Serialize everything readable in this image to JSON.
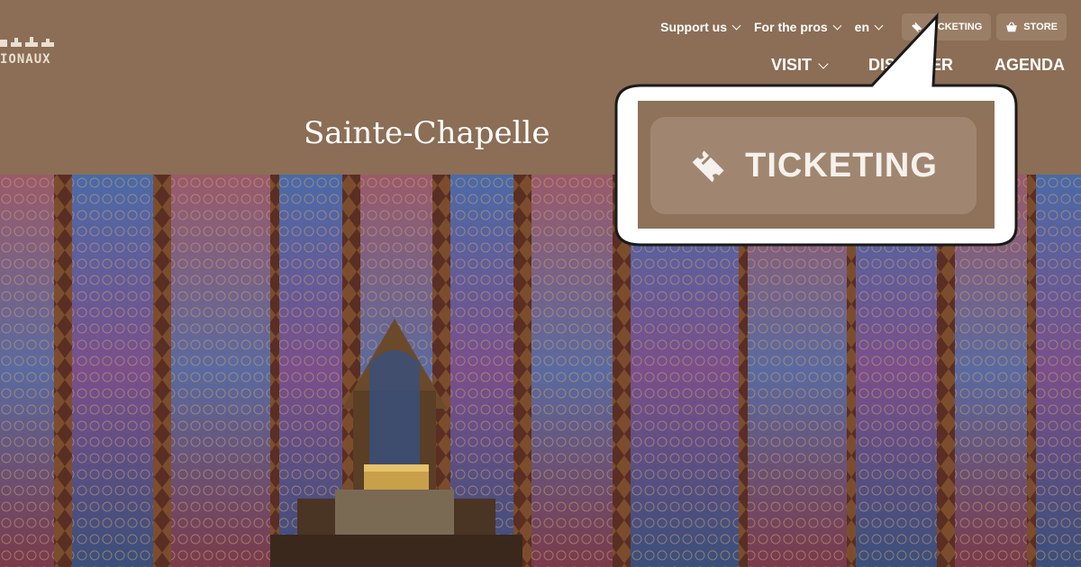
{
  "header": {
    "logo_text": "IONAUX",
    "topnav": {
      "support_label": "Support us",
      "pros_label": "For the pros",
      "lang_label": "en",
      "ticketing_label": "TICKETING",
      "store_label": "STORE"
    },
    "mainnav": {
      "visit_label": "VISIT",
      "discover_label": "DISCOVER",
      "agenda_label": "AGENDA"
    },
    "page_title": "Sainte-Chapelle"
  },
  "callout": {
    "zoom_label": "TICKETING"
  },
  "colors": {
    "header_bg": "#8b6e55",
    "pill_bg": "#9a7e66",
    "callout_bg": "#8e725a"
  },
  "icons": [
    "ticket-icon",
    "basket-icon",
    "chevron-down-icon"
  ]
}
